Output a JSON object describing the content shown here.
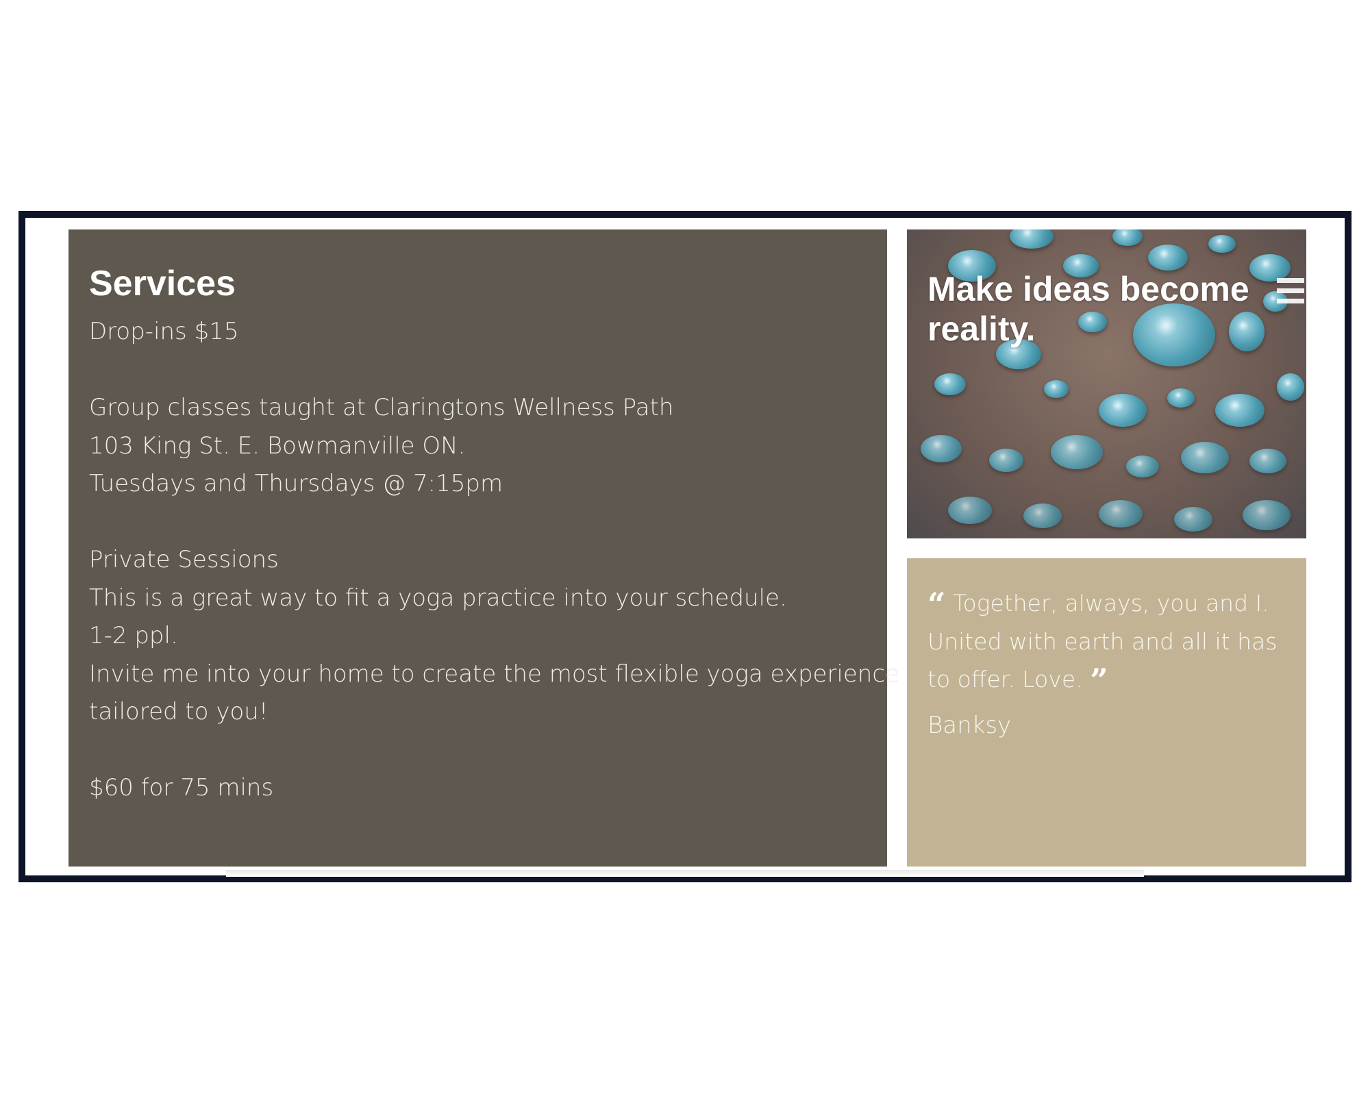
{
  "services": {
    "title": "Services",
    "lines": [
      "Drop-ins $15",
      "",
      "Group classes taught at Claringtons Wellness Path",
      "103 King St. E. Bowmanville ON.",
      "Tuesdays and Thursdays @ 7:15pm",
      "",
      "Private Sessions",
      "This is a great way to fit a yoga practice into your schedule.",
      "1-2 ppl.",
      "Invite me into your home to create the most flexible yoga experience",
      "tailored to you!",
      "",
      "$60 for 75 mins"
    ]
  },
  "feature": {
    "heading": "Make ideas become reality."
  },
  "quote": {
    "text": "Together, always, you and I. United with earth and all it has to offer. Love.",
    "author": "Banksy"
  },
  "colors": {
    "frame": "#0d1428",
    "services_bg": "#5e584e",
    "quote_bg": "#c2b394"
  },
  "icons": {
    "menu": "hamburger-menu-icon",
    "quote_open": "quote-open-icon",
    "quote_close": "quote-close-icon"
  }
}
